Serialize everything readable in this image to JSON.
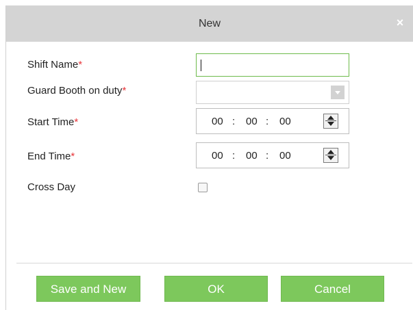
{
  "dialog": {
    "title": "New",
    "close_label": "×"
  },
  "form": {
    "shift_name": {
      "label": "Shift Name",
      "required_mark": "*",
      "value": ""
    },
    "guard_booth": {
      "label": "Guard Booth on duty",
      "required_mark": "*",
      "selected": ""
    },
    "start_time": {
      "label": "Start Time",
      "required_mark": "*",
      "hh": "00",
      "mm": "00",
      "ss": "00",
      "sep": ":"
    },
    "end_time": {
      "label": "End Time",
      "required_mark": "*",
      "hh": "00",
      "mm": "00",
      "ss": "00",
      "sep": ":"
    },
    "cross_day": {
      "label": "Cross Day",
      "checked": false
    }
  },
  "buttons": {
    "save_and_new": "Save and New",
    "ok": "OK",
    "cancel": "Cancel"
  },
  "colors": {
    "accent_green": "#7dc85c",
    "required_red": "#e8353a",
    "titlebar_gray": "#d4d4d4"
  },
  "icons": [
    "close-icon",
    "dropdown-arrow-icon",
    "spinner-up-icon",
    "spinner-down-icon"
  ]
}
